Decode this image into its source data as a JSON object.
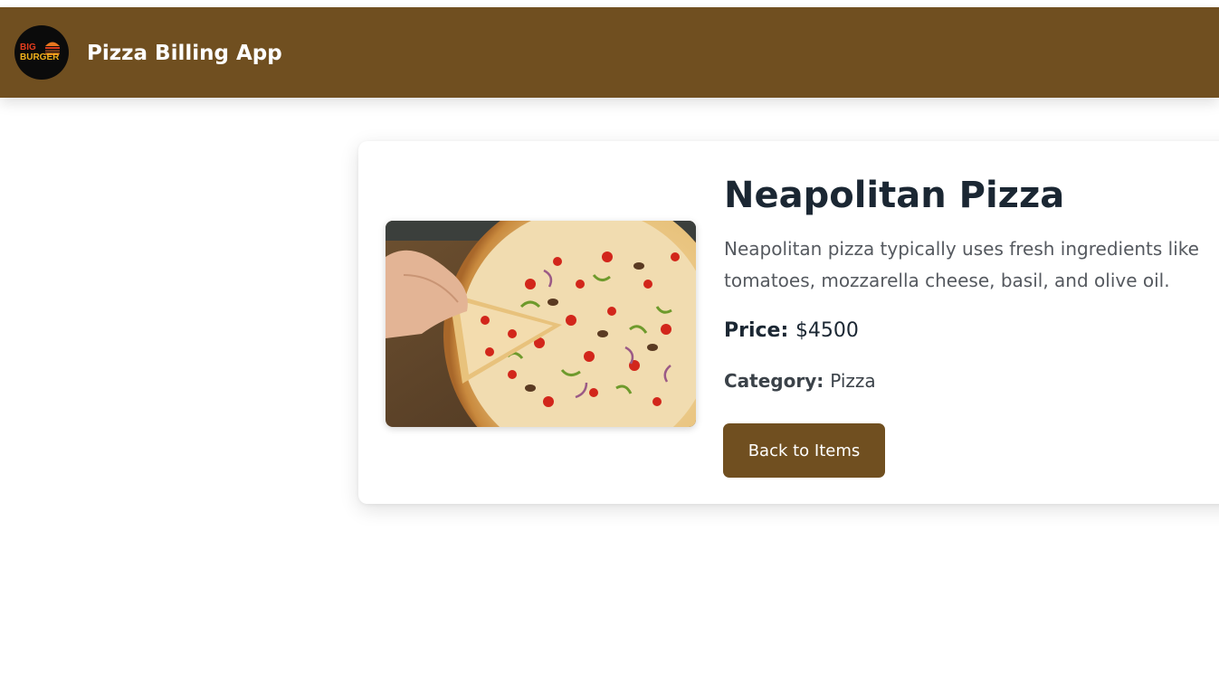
{
  "navbar": {
    "logo_text_line1": "BIG",
    "logo_text_line2": "BURGER",
    "title": "Pizza Billing App",
    "background": "#704f20"
  },
  "item": {
    "name": "Neapolitan Pizza",
    "description": "Neapolitan pizza typically uses fresh ingredients like tomatoes, mozzarella cheese, basil, and olive oil.",
    "price_label": "Price:",
    "price_value": "$4500",
    "category_label": "Category:",
    "category_value": "Pizza",
    "image_icon": "pizza-photo"
  },
  "actions": {
    "back_label": "Back to Items"
  },
  "colors": {
    "accent": "#704f20",
    "heading": "#1b2733",
    "body_text": "#55595f"
  }
}
